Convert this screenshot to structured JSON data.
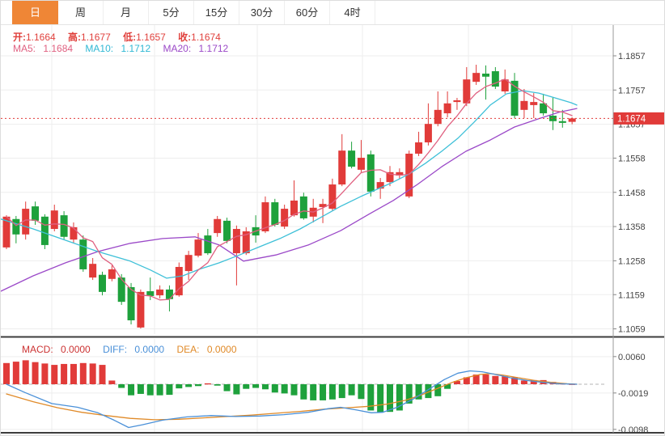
{
  "tabs": {
    "items": [
      "日",
      "周",
      "月",
      "5分",
      "15分",
      "30分",
      "60分",
      "4时"
    ],
    "active_index": 0
  },
  "ohlc": {
    "open_label": "开:",
    "open": "1.1664",
    "high_label": "高:",
    "high": "1.1677",
    "low_label": "低:",
    "low": "1.1657",
    "close_label": "收:",
    "close": "1.1674"
  },
  "ma_readout": {
    "ma5_label": "MA5:",
    "ma5": "1.1684",
    "ma10_label": "MA10:",
    "ma10": "1.1712",
    "ma20_label": "MA20:",
    "ma20": "1.1712"
  },
  "macd_readout": {
    "macd_label": "MACD:",
    "macd": "0.0000",
    "diff_label": "DIFF:",
    "diff": "0.0000",
    "dea_label": "DEA:",
    "dea": "0.0000"
  },
  "colors": {
    "up": "#e13b39",
    "down": "#1ea13c",
    "ma5": "#e06080",
    "ma10": "#3ec0d8",
    "ma20": "#9b49c8",
    "diff": "#4a90d8",
    "dea": "#e08a28",
    "active_tab_bg": "#ef8636",
    "badge_bg": "#e13b39",
    "grid": "#ededed",
    "axis_line": "#9a9a9a",
    "pane_divider": "#3d3d3d",
    "current_price_line": "#e13b39",
    "tick_text": "#444444"
  },
  "chart_data": {
    "type": "candlestick+macd",
    "title": "",
    "legend": [
      "MA5",
      "MA10",
      "MA20",
      "MACD",
      "DIFF",
      "DEA"
    ],
    "price_axis_ticks": [
      "1.1857",
      "1.1757",
      "1.1657",
      "1.1558",
      "1.1458",
      "1.1358",
      "1.1258",
      "1.1159",
      "1.1059"
    ],
    "macd_axis_ticks": [
      "0.0060",
      "-0.0019",
      "-0.0098"
    ],
    "current_price": 1.1674,
    "current_price_label": "1.1674",
    "price_range": [
      1.1857,
      1.1059
    ],
    "macd_range": [
      0.006,
      -0.0098
    ],
    "candles_ohlc": [
      [
        1.1297,
        1.1391,
        1.1292,
        1.1387
      ],
      [
        1.138,
        1.1389,
        1.1309,
        1.1335
      ],
      [
        1.1335,
        1.1431,
        1.132,
        1.141
      ],
      [
        1.1417,
        1.1431,
        1.1363,
        1.1375
      ],
      [
        1.1387,
        1.1394,
        1.1292,
        1.1304
      ],
      [
        1.1351,
        1.1422,
        1.1344,
        1.1405
      ],
      [
        1.1391,
        1.1403,
        1.132,
        1.1328
      ],
      [
        1.132,
        1.137,
        1.1311,
        1.1356
      ],
      [
        1.132,
        1.1332,
        1.1226,
        1.1233
      ],
      [
        1.1209,
        1.1266,
        1.1202,
        1.1249
      ],
      [
        1.1217,
        1.1226,
        1.1157,
        1.1167
      ],
      [
        1.1205,
        1.1245,
        1.1198,
        1.1233
      ],
      [
        1.1209,
        1.1219,
        1.1129,
        1.1138
      ],
      [
        1.1181,
        1.1193,
        1.1072,
        1.1084
      ],
      [
        1.1063,
        1.1174,
        1.106,
        1.1167
      ],
      [
        1.1169,
        1.1209,
        1.1143,
        1.1155
      ],
      [
        1.1157,
        1.1186,
        1.1148,
        1.1174
      ],
      [
        1.1174,
        1.1186,
        1.111,
        1.1146
      ],
      [
        1.1157,
        1.1253,
        1.1153,
        1.124
      ],
      [
        1.1228,
        1.1287,
        1.1202,
        1.1275
      ],
      [
        1.1273,
        1.1339,
        1.1268,
        1.132
      ],
      [
        1.1332,
        1.1351,
        1.1275,
        1.128
      ],
      [
        1.1339,
        1.1389,
        1.1328,
        1.138
      ],
      [
        1.1375,
        1.1384,
        1.1309,
        1.1316
      ],
      [
        1.128,
        1.1361,
        1.1186,
        1.1351
      ],
      [
        1.128,
        1.1356,
        1.1275,
        1.1344
      ],
      [
        1.1356,
        1.1391,
        1.1311,
        1.1332
      ],
      [
        1.1344,
        1.1446,
        1.1339,
        1.1429
      ],
      [
        1.1429,
        1.1439,
        1.1358,
        1.1363
      ],
      [
        1.1358,
        1.1422,
        1.1351,
        1.141
      ],
      [
        1.1391,
        1.1493,
        1.1387,
        1.1434
      ],
      [
        1.1446,
        1.1457,
        1.1378,
        1.1382
      ],
      [
        1.1387,
        1.1439,
        1.137,
        1.1413
      ],
      [
        1.1415,
        1.1439,
        1.1368,
        1.1424
      ],
      [
        1.141,
        1.1498,
        1.1405,
        1.1481
      ],
      [
        1.1481,
        1.1628,
        1.1476,
        1.158
      ],
      [
        1.158,
        1.1606,
        1.1528,
        1.1533
      ],
      [
        1.1524,
        1.1611,
        1.1517,
        1.1559
      ],
      [
        1.1569,
        1.158,
        1.1446,
        1.146
      ],
      [
        1.1469,
        1.15,
        1.1439,
        1.1488
      ],
      [
        1.1488,
        1.1535,
        1.1476,
        1.1517
      ],
      [
        1.1507,
        1.1528,
        1.1498,
        1.1517
      ],
      [
        1.1446,
        1.158,
        1.1441,
        1.1571
      ],
      [
        1.1571,
        1.1635,
        1.1564,
        1.1604
      ],
      [
        1.1604,
        1.1718,
        1.1595,
        1.1658
      ],
      [
        1.1658,
        1.1753,
        1.1651,
        1.1699
      ],
      [
        1.1689,
        1.1753,
        1.1677,
        1.1718
      ],
      [
        1.1722,
        1.1734,
        1.1699,
        1.1727
      ],
      [
        1.1718,
        1.1824,
        1.171,
        1.1788
      ],
      [
        1.1781,
        1.1831,
        1.1772,
        1.1807
      ],
      [
        1.1805,
        1.1829,
        1.1729,
        1.1796
      ],
      [
        1.1812,
        1.1824,
        1.176,
        1.1767
      ],
      [
        1.1753,
        1.1817,
        1.1746,
        1.1788
      ],
      [
        1.1784,
        1.1807,
        1.1675,
        1.1682
      ],
      [
        1.1699,
        1.176,
        1.1675,
        1.1725
      ],
      [
        1.1713,
        1.1748,
        1.1675,
        1.1722
      ],
      [
        1.1718,
        1.1746,
        1.1682,
        1.1689
      ],
      [
        1.1682,
        1.1736,
        1.164,
        1.1666
      ],
      [
        1.1666,
        1.1699,
        1.1647,
        1.1661
      ],
      [
        1.1664,
        1.1677,
        1.1657,
        1.1674
      ]
    ],
    "ma10_points": [
      [
        0,
        1.138
      ],
      [
        40,
        1.1351
      ],
      [
        80,
        1.1318
      ],
      [
        120,
        1.1285
      ],
      [
        160,
        1.1257
      ],
      [
        185,
        1.1231
      ],
      [
        205,
        1.1207
      ],
      [
        225,
        1.1214
      ],
      [
        245,
        1.1233
      ],
      [
        270,
        1.1252
      ],
      [
        295,
        1.1275
      ],
      [
        320,
        1.1299
      ],
      [
        345,
        1.1323
      ],
      [
        370,
        1.1351
      ],
      [
        395,
        1.1384
      ],
      [
        420,
        1.1417
      ],
      [
        445,
        1.1446
      ],
      [
        465,
        1.1467
      ],
      [
        485,
        1.1488
      ],
      [
        505,
        1.1512
      ],
      [
        525,
        1.1543
      ],
      [
        545,
        1.1578
      ],
      [
        565,
        1.1616
      ],
      [
        585,
        1.1663
      ],
      [
        605,
        1.1713
      ],
      [
        625,
        1.1746
      ],
      [
        645,
        1.1755
      ],
      [
        665,
        1.1748
      ],
      [
        685,
        1.1734
      ],
      [
        705,
        1.172
      ],
      [
        712,
        1.1713
      ]
    ],
    "ma20_points": [
      [
        0,
        1.1169
      ],
      [
        40,
        1.1214
      ],
      [
        80,
        1.1252
      ],
      [
        120,
        1.1285
      ],
      [
        160,
        1.1309
      ],
      [
        200,
        1.1323
      ],
      [
        240,
        1.1328
      ],
      [
        270,
        1.1304
      ],
      [
        300,
        1.1257
      ],
      [
        340,
        1.1275
      ],
      [
        380,
        1.1304
      ],
      [
        420,
        1.1346
      ],
      [
        455,
        1.1394
      ],
      [
        485,
        1.1434
      ],
      [
        515,
        1.1481
      ],
      [
        545,
        1.1533
      ],
      [
        575,
        1.1578
      ],
      [
        605,
        1.1611
      ],
      [
        635,
        1.1649
      ],
      [
        665,
        1.1673
      ],
      [
        690,
        1.1692
      ],
      [
        712,
        1.1703
      ]
    ],
    "macd_hist": [
      0.0046,
      0.0049,
      0.0052,
      0.0048,
      0.0045,
      0.0042,
      0.0044,
      0.0044,
      0.0046,
      0.0045,
      0.0042,
      0.0008,
      -0.0008,
      -0.0024,
      -0.0021,
      -0.0024,
      -0.0024,
      -0.0023,
      -0.0009,
      -0.0006,
      -0.0004,
      0.0002,
      -0.0003,
      -0.0015,
      -0.0022,
      -0.001,
      -0.0008,
      -0.0011,
      -0.0018,
      -0.002,
      -0.0024,
      -0.0033,
      -0.0035,
      -0.0035,
      -0.0033,
      -0.003,
      -0.0024,
      -0.0032,
      -0.0057,
      -0.0061,
      -0.006,
      -0.0057,
      -0.0042,
      -0.0033,
      -0.003,
      -0.0026,
      -0.001,
      0.0007,
      0.0015,
      0.0021,
      0.0021,
      0.0018,
      0.0017,
      0.0015,
      0.0008,
      0.0009,
      0.0009,
      0.0005,
      0.0002,
      0.0001
    ],
    "diff_points": [
      [
        7,
        0.0
      ],
      [
        30,
        -0.0018
      ],
      [
        63,
        -0.0042
      ],
      [
        95,
        -0.005
      ],
      [
        120,
        -0.0062
      ],
      [
        140,
        -0.0078
      ],
      [
        158,
        -0.0094
      ],
      [
        175,
        -0.0088
      ],
      [
        200,
        -0.0078
      ],
      [
        230,
        -0.0071
      ],
      [
        260,
        -0.0068
      ],
      [
        290,
        -0.007
      ],
      [
        320,
        -0.0069
      ],
      [
        350,
        -0.0066
      ],
      [
        380,
        -0.0061
      ],
      [
        405,
        -0.0053
      ],
      [
        420,
        -0.005
      ],
      [
        440,
        -0.0056
      ],
      [
        458,
        -0.0062
      ],
      [
        472,
        -0.0061
      ],
      [
        490,
        -0.005
      ],
      [
        510,
        -0.0032
      ],
      [
        530,
        -0.001
      ],
      [
        548,
        0.001
      ],
      [
        565,
        0.0024
      ],
      [
        580,
        0.0029
      ],
      [
        595,
        0.0027
      ],
      [
        612,
        0.0021
      ],
      [
        630,
        0.0014
      ],
      [
        650,
        0.0008
      ],
      [
        670,
        0.0004
      ],
      [
        690,
        0.0001
      ],
      [
        712,
        0.0
      ]
    ],
    "dea_points": [
      [
        7,
        -0.0021
      ],
      [
        40,
        -0.0038
      ],
      [
        70,
        -0.0051
      ],
      [
        100,
        -0.0061
      ],
      [
        130,
        -0.0068
      ],
      [
        160,
        -0.0074
      ],
      [
        190,
        -0.0077
      ],
      [
        220,
        -0.0076
      ],
      [
        250,
        -0.0073
      ],
      [
        280,
        -0.007
      ],
      [
        310,
        -0.0067
      ],
      [
        340,
        -0.0063
      ],
      [
        370,
        -0.0059
      ],
      [
        400,
        -0.0054
      ],
      [
        430,
        -0.0051
      ],
      [
        455,
        -0.0048
      ],
      [
        478,
        -0.0043
      ],
      [
        500,
        -0.0035
      ],
      [
        520,
        -0.0023
      ],
      [
        540,
        -0.0009
      ],
      [
        558,
        0.0004
      ],
      [
        575,
        0.0014
      ],
      [
        592,
        0.0021
      ],
      [
        605,
        0.0023
      ],
      [
        620,
        0.002
      ],
      [
        640,
        0.0014
      ],
      [
        660,
        0.0008
      ],
      [
        680,
        0.0004
      ],
      [
        700,
        0.0001
      ],
      [
        712,
        0.0
      ]
    ],
    "grid": true,
    "vertical_gridlines_x": [
      63,
      190,
      317,
      447,
      578,
      706
    ]
  }
}
